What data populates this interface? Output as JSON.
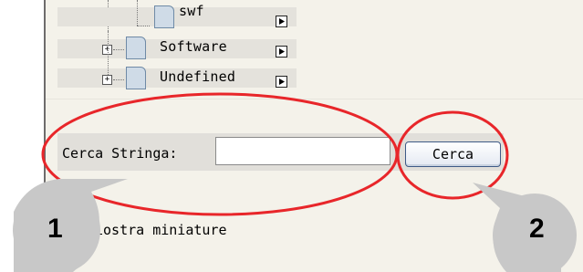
{
  "tree": {
    "items": [
      {
        "label": "swf"
      },
      {
        "label": "Software"
      },
      {
        "label": "Undefined"
      }
    ]
  },
  "search": {
    "label": "Cerca Stringa:",
    "value": "",
    "button_label": "Cerca"
  },
  "thumbnails": {
    "label": "iostra miniature"
  },
  "callouts": [
    {
      "number": "1"
    },
    {
      "number": "2"
    }
  ],
  "colors": {
    "highlight_ellipse": "#e8262a",
    "callout_bubble": "#c8c8c8",
    "panel_background": "#f4f2ea"
  }
}
